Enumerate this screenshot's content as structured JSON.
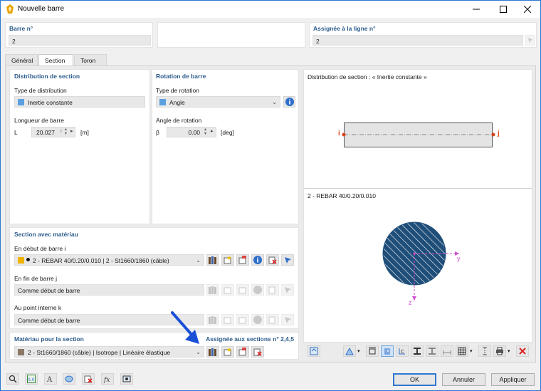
{
  "window": {
    "title": "Nouvelle barre"
  },
  "header": {
    "member_no_label": "Barre n°",
    "member_no_value": "2",
    "assigned_line_label": "Assignée à la ligne n°",
    "assigned_line_value": "2"
  },
  "tabs": [
    {
      "label": "Général"
    },
    {
      "label": "Section"
    },
    {
      "label": "Toron"
    }
  ],
  "distribution": {
    "heading": "Distribution de section",
    "type_label": "Type de distribution",
    "type_value": "Inertie constante",
    "type_color": "#5aa0e0",
    "length_label": "Longueur de barre",
    "length_symbol": "L",
    "length_value": "20.027",
    "length_unit": "[m]"
  },
  "rotation": {
    "heading": "Rotation de barre",
    "type_label": "Type de rotation",
    "type_value": "Angle",
    "type_color": "#5aa0e0",
    "angle_label": "Angle de rotation",
    "angle_symbol": "β",
    "angle_value": "0.00",
    "angle_unit": "[deg]"
  },
  "section_material": {
    "heading": "Section avec matériau",
    "start_label": "En début de barre i",
    "start_value": "2 - REBAR 40/0.20/0.010 | 2 - St1660/1860 (câble)",
    "start_color": "#f0b400",
    "end_label": "En fin de barre j",
    "end_value": "Comme début de barre",
    "internal_label": "Au point interne k",
    "internal_value": "Comme début de barre"
  },
  "material": {
    "heading": "Matériau pour la section",
    "assigned_text": "Assignée aux sections n° 2,4,5",
    "value": "2 - St1660/1860 (câble) | Isotrope | Linéaire élastique",
    "color": "#8c7766"
  },
  "preview": {
    "top_title": "Distribution de section : « Inertie constante »",
    "node_i": "i",
    "node_j": "j",
    "section_title": "2 - REBAR 40/0.20/0.010",
    "axis_y": "y",
    "axis_z": "z"
  },
  "footer": {
    "ok_label": "OK",
    "cancel_label": "Annuler",
    "apply_label": "Appliquer"
  },
  "colors": {
    "accent_blue": "#1f4e79",
    "axis_magenta": "#d64fd6",
    "node_red": "#d9441c",
    "arrow_blue": "#1a4fd8"
  }
}
